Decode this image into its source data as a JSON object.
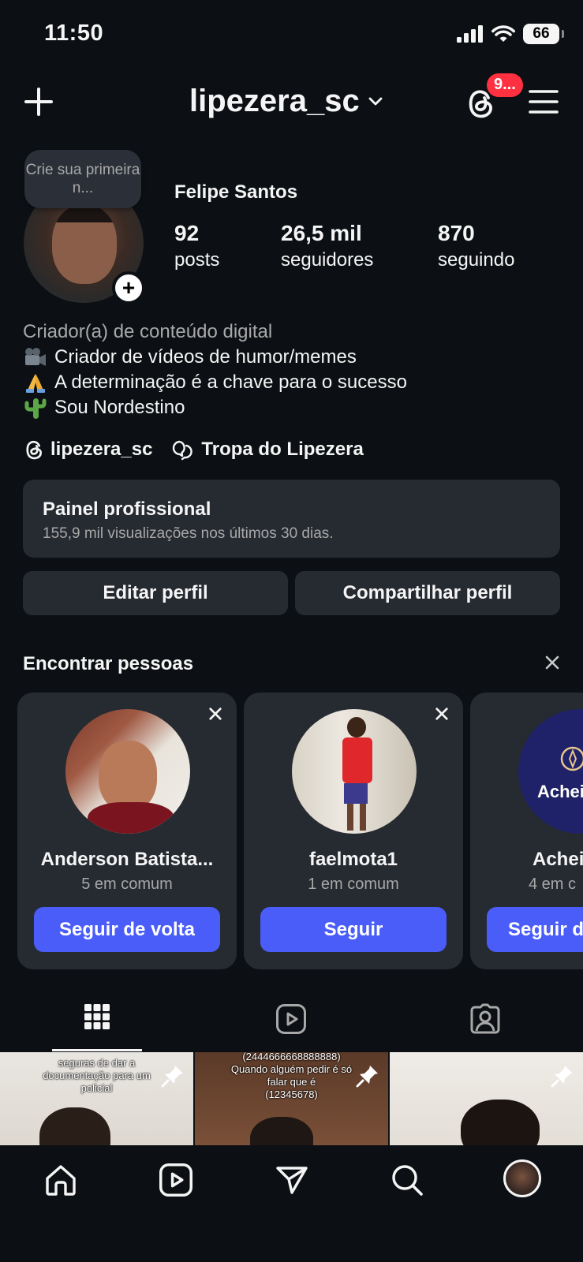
{
  "status_bar": {
    "time": "11:50",
    "battery": "66"
  },
  "header": {
    "username": "lipezera_sc",
    "notification_badge": "9..."
  },
  "profile": {
    "note_bubble": "Crie sua primeira n...",
    "display_name": "Felipe Santos",
    "stats": [
      {
        "value": "92",
        "label": "posts"
      },
      {
        "value": "26,5 mil",
        "label": "seguidores"
      },
      {
        "value": "870",
        "label": "seguindo"
      }
    ],
    "category": "Criador(a) de conteúdo digital",
    "bio_lines": [
      {
        "icon": "movie-camera-emoji",
        "text": "Criador de vídeos de humor/memes"
      },
      {
        "icon": "praying-hands-emoji",
        "text": "A determinação é a chave para o sucesso"
      },
      {
        "icon": "cactus-emoji",
        "text": "Sou Nordestino"
      }
    ],
    "threads_link": "lipezera_sc",
    "channel_link": "Tropa do Lipezera"
  },
  "dashboard": {
    "title": "Painel profissional",
    "subtitle": "155,9 mil visualizações nos últimos 30 dias."
  },
  "actions": {
    "edit": "Editar perfil",
    "share": "Compartilhar perfil"
  },
  "suggestions": {
    "title": "Encontrar pessoas",
    "cards": [
      {
        "name": "Anderson Batista...",
        "mutual": "5 em comum",
        "button": "Seguir de volta"
      },
      {
        "name": "faelmota1",
        "mutual": "1 em comum",
        "button": "Seguir"
      },
      {
        "name": "Achei",
        "mutual": "4 em c",
        "button": "Seguir d",
        "logo_text": "Achei"
      }
    ]
  },
  "tabs": [
    "grid-icon",
    "reels-icon",
    "tagged-icon"
  ],
  "grid_posts": [
    {
      "caption": "seguras de dar a\ndocumentação para um\npolicial"
    },
    {
      "caption": "(2444666668888888)\nQuando alguém pedir é só\nfalar que é\n(12345678)"
    },
    {
      "caption": ""
    }
  ],
  "colors": {
    "background": "#0c1014",
    "surface": "#262a31",
    "primary_button": "#4a5df9",
    "badge": "#ff3040"
  }
}
